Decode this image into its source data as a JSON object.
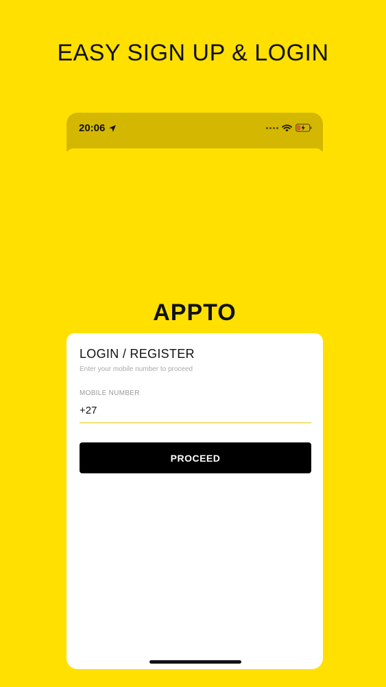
{
  "headline": "EASY SIGN UP & LOGIN",
  "status_bar": {
    "time": "20:06",
    "icons": [
      "location-arrow-icon",
      "signal-dots-icon",
      "wifi-icon",
      "battery-charging-icon"
    ]
  },
  "brand": "APPTO",
  "login": {
    "title": "LOGIN / REGISTER",
    "subtitle": "Enter your mobile number to proceed",
    "field_label": "MOBILE NUMBER",
    "field_value": "+27",
    "button_label": "PROCEED"
  },
  "colors": {
    "background": "#FFE000",
    "status_bar": "#D4B700",
    "button": "#000000",
    "field_underline": "#E6C800"
  }
}
